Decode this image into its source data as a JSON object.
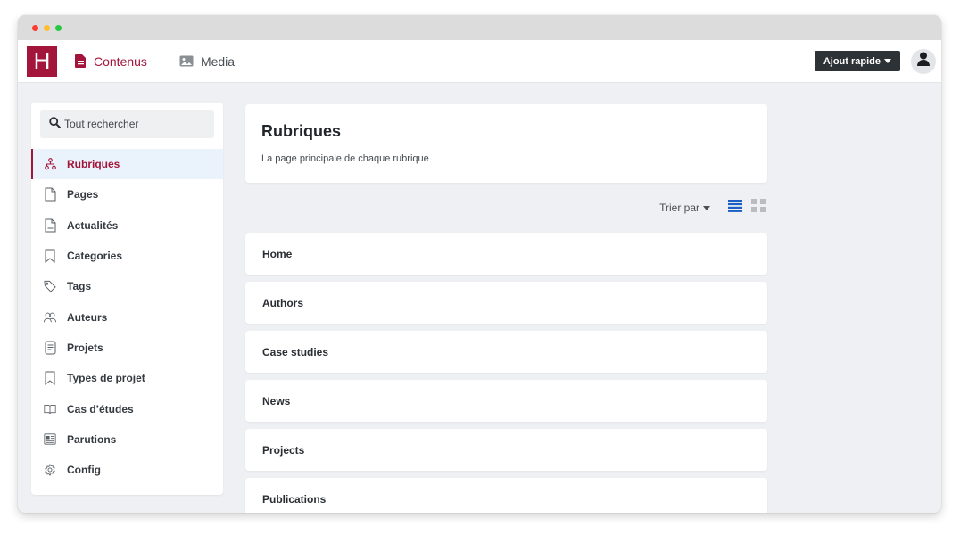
{
  "window": {
    "traffic_lights": [
      "#ff3b30",
      "#ffbd2e",
      "#28c840"
    ]
  },
  "topnav": {
    "logo_letter": "H",
    "brand_color": "#a3153a",
    "items": [
      {
        "label": "Contenus",
        "icon": "document-icon",
        "active": true
      },
      {
        "label": "Media",
        "icon": "image-icon",
        "active": false
      }
    ],
    "quick_add_label": "Ajout rapide",
    "avatar_icon": "user-icon"
  },
  "sidebar": {
    "search_placeholder": "Tout rechercher",
    "items": [
      {
        "label": "Rubriques",
        "icon": "sitemap-icon",
        "active": true
      },
      {
        "label": "Pages",
        "icon": "page-icon"
      },
      {
        "label": "Actualités",
        "icon": "news-icon"
      },
      {
        "label": "Categories",
        "icon": "bookmark-icon"
      },
      {
        "label": "Tags",
        "icon": "tag-icon"
      },
      {
        "label": "Auteurs",
        "icon": "users-icon"
      },
      {
        "label": "Projets",
        "icon": "project-icon"
      },
      {
        "label": "Types de projet",
        "icon": "bookmark-icon"
      },
      {
        "label": "Cas d’études",
        "icon": "book-icon"
      },
      {
        "label": "Parutions",
        "icon": "newspaper-icon"
      },
      {
        "label": "Config",
        "icon": "gear-icon"
      }
    ]
  },
  "main": {
    "title": "Rubriques",
    "subtitle": "La page principale de chaque rubrique",
    "sort_label": "Trier par",
    "view_modes": [
      "list-view-icon",
      "grid-view-icon"
    ],
    "rows": [
      "Home",
      "Authors",
      "Case studies",
      "News",
      "Projects",
      "Publications"
    ]
  }
}
